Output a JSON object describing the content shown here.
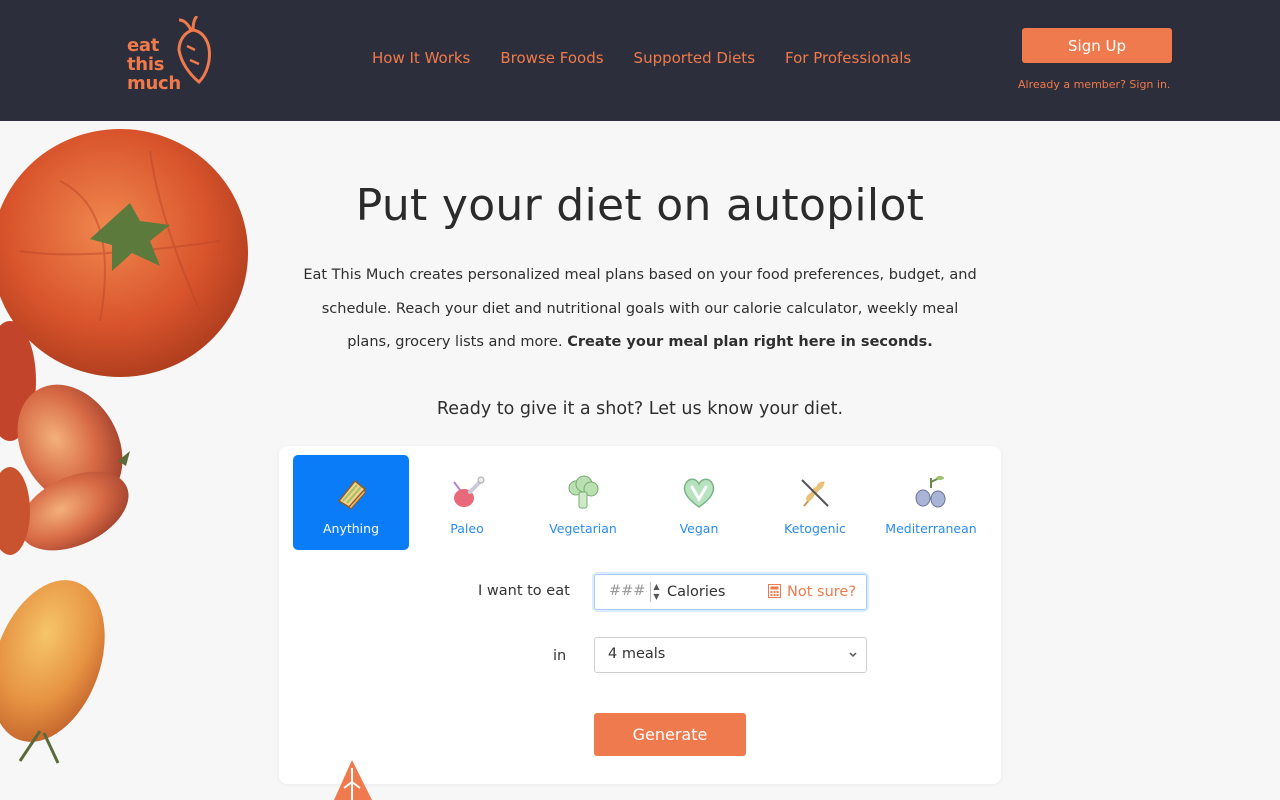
{
  "brand": {
    "logo_text": "eat this much",
    "accent": "#ee7a4d",
    "header_bg": "#2d2e3b",
    "active_blue": "#0a7cf7"
  },
  "nav": {
    "items": [
      {
        "label": "How It Works"
      },
      {
        "label": "Browse Foods"
      },
      {
        "label": "Supported Diets"
      },
      {
        "label": "For Professionals"
      }
    ],
    "signup_label": "Sign Up",
    "signin_label": "Already a member? Sign in."
  },
  "hero": {
    "title": "Put your diet on autopilot",
    "description": "Eat This Much creates personalized meal plans based on your food preferences, budget, and schedule. Reach your diet and nutritional goals with our calorie calculator, weekly meal plans, grocery lists and more.",
    "description_bold": "Create your meal plan right here in seconds.",
    "prompt": "Ready to give it a shot? Let us know your diet."
  },
  "diets": [
    {
      "label": "Anything",
      "icon": "sandwich-icon",
      "selected": true
    },
    {
      "label": "Paleo",
      "icon": "drumstick-icon",
      "selected": false
    },
    {
      "label": "Vegetarian",
      "icon": "broccoli-icon",
      "selected": false
    },
    {
      "label": "Vegan",
      "icon": "vegan-heart-icon",
      "selected": false
    },
    {
      "label": "Ketogenic",
      "icon": "no-wheat-icon",
      "selected": false
    },
    {
      "label": "Mediterranean",
      "icon": "olives-icon",
      "selected": false
    }
  ],
  "form": {
    "eat_label": "I want to eat",
    "calories_placeholder": "####",
    "calories_unit": "Calories",
    "not_sure_label": "Not sure?",
    "in_label": "in",
    "meals_value": "4 meals",
    "generate_label": "Generate"
  }
}
